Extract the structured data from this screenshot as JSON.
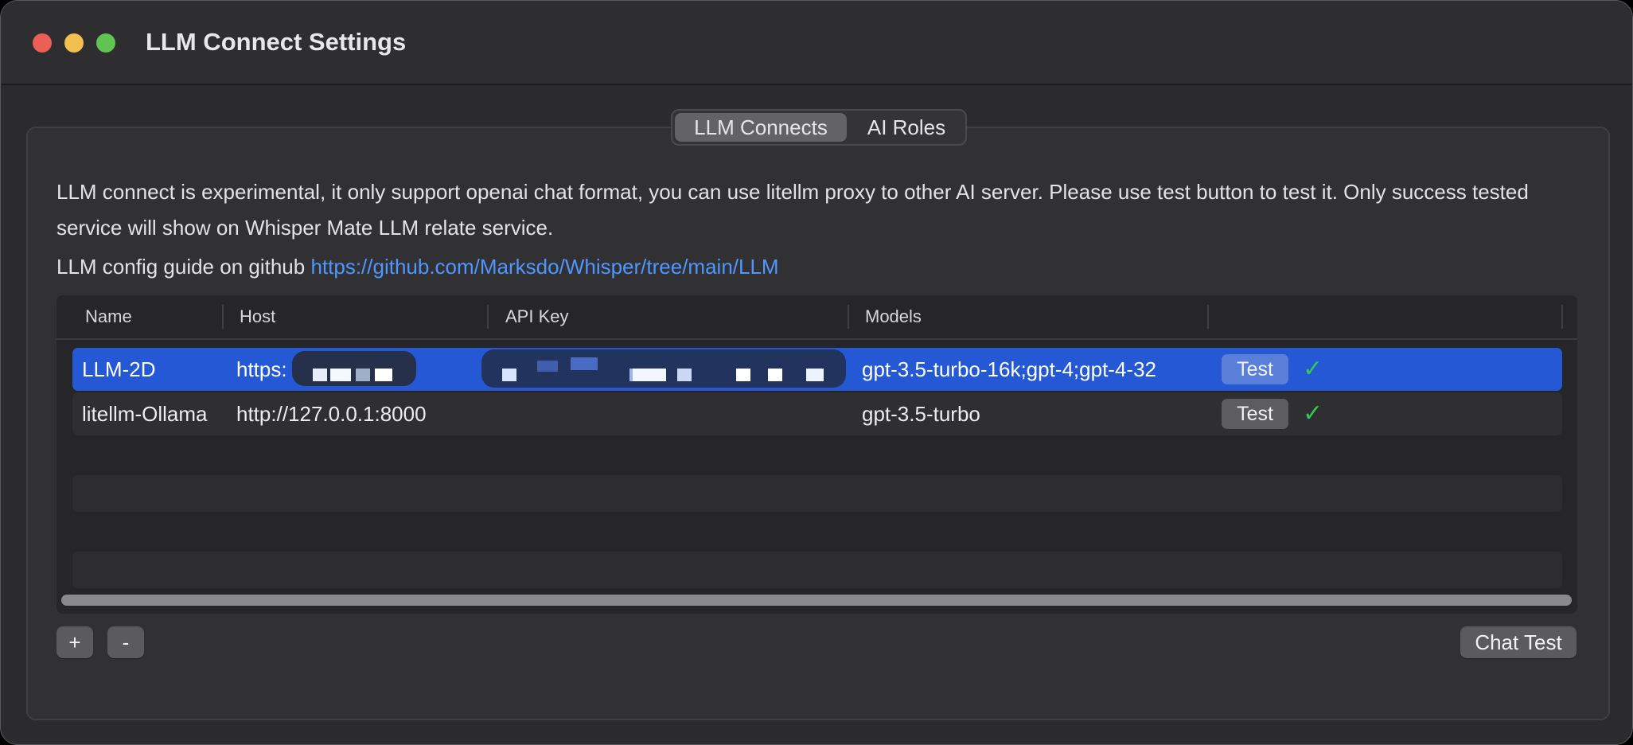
{
  "window": {
    "title": "LLM Connect Settings"
  },
  "tabs": [
    {
      "label": "LLM Connects",
      "active": true
    },
    {
      "label": "AI Roles",
      "active": false
    }
  ],
  "description": "LLM connect is experimental, it only support openai chat format, you can use litellm proxy to other AI server. Please use test button to test it. Only success tested service will show on Whisper Mate LLM relate service.",
  "guide": {
    "text": "LLM config guide on github ",
    "link": "https://github.com/Marksdo/Whisper/tree/main/LLM"
  },
  "table": {
    "columns": [
      "Name",
      "Host",
      "API Key",
      "Models",
      ""
    ],
    "rows": [
      {
        "name": "LLM-2D",
        "host": "https:",
        "api_key": "",
        "models": "gpt-3.5-turbo-16k;gpt-4;gpt-4-32",
        "test_label": "Test",
        "status": "✓",
        "selected": true
      },
      {
        "name": "litellm-Ollama",
        "host": "http://127.0.0.1:8000",
        "api_key": "",
        "models": "gpt-3.5-turbo",
        "test_label": "Test",
        "status": "✓",
        "selected": false
      }
    ]
  },
  "buttons": {
    "add": "+",
    "remove": "-",
    "chat_test": "Chat Test"
  },
  "colors": {
    "accent": "#2458d4",
    "link": "#4f96ff",
    "success": "#34c759"
  }
}
